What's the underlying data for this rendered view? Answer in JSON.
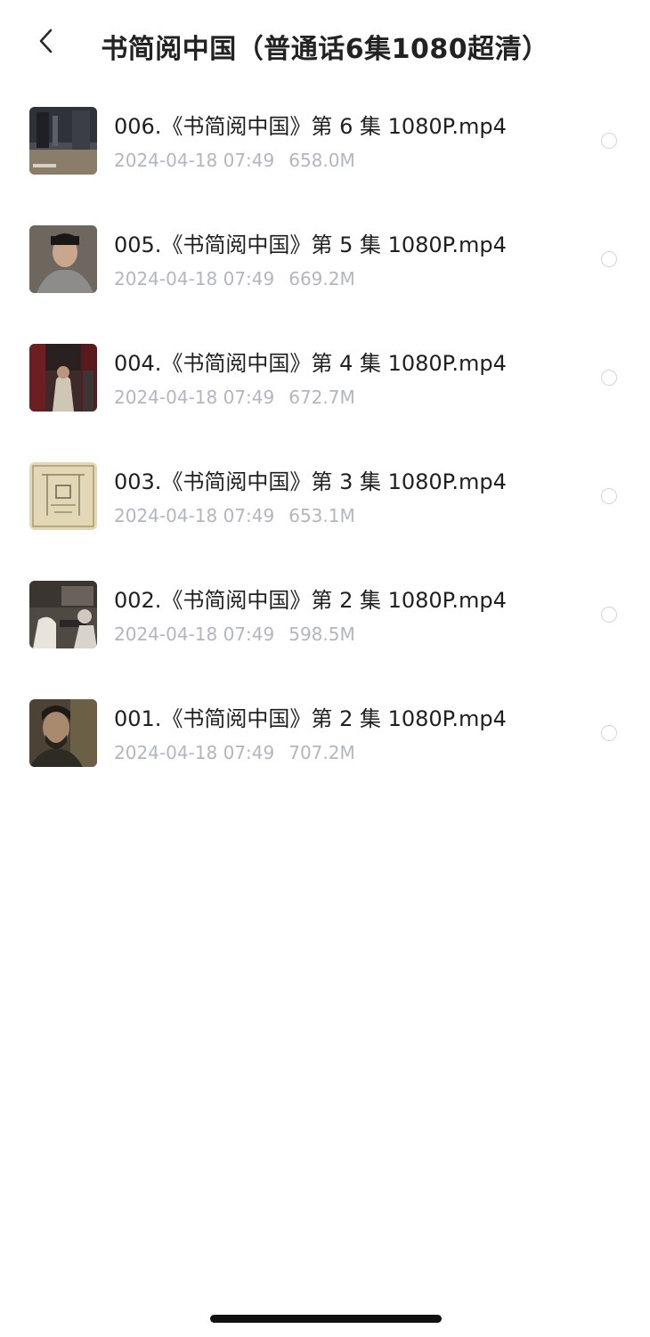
{
  "header": {
    "title": "书简阅中国（普通话6集1080超清）",
    "back_icon": "chevron-left-icon"
  },
  "files": [
    {
      "name": "006.《书简阅中国》第 6 集 1080P.mp4",
      "date": "2024-04-18 07:49",
      "size": "658.0M",
      "selected": false
    },
    {
      "name": "005.《书简阅中国》第 5 集 1080P.mp4",
      "date": "2024-04-18 07:49",
      "size": "669.2M",
      "selected": false
    },
    {
      "name": "004.《书简阅中国》第 4 集 1080P.mp4",
      "date": "2024-04-18 07:49",
      "size": "672.7M",
      "selected": false
    },
    {
      "name": "003.《书简阅中国》第 3 集 1080P.mp4",
      "date": "2024-04-18 07:49",
      "size": "653.1M",
      "selected": false
    },
    {
      "name": "002.《书简阅中国》第 2 集 1080P.mp4",
      "date": "2024-04-18 07:49",
      "size": "598.5M",
      "selected": false
    },
    {
      "name": "001.《书简阅中国》第 2 集 1080P.mp4",
      "date": "2024-04-18 07:49",
      "size": "707.2M",
      "selected": false
    }
  ],
  "colors": {
    "text_primary": "#1f1f1f",
    "text_secondary": "#b3b6bc",
    "radio_border": "#d3d5d9"
  }
}
